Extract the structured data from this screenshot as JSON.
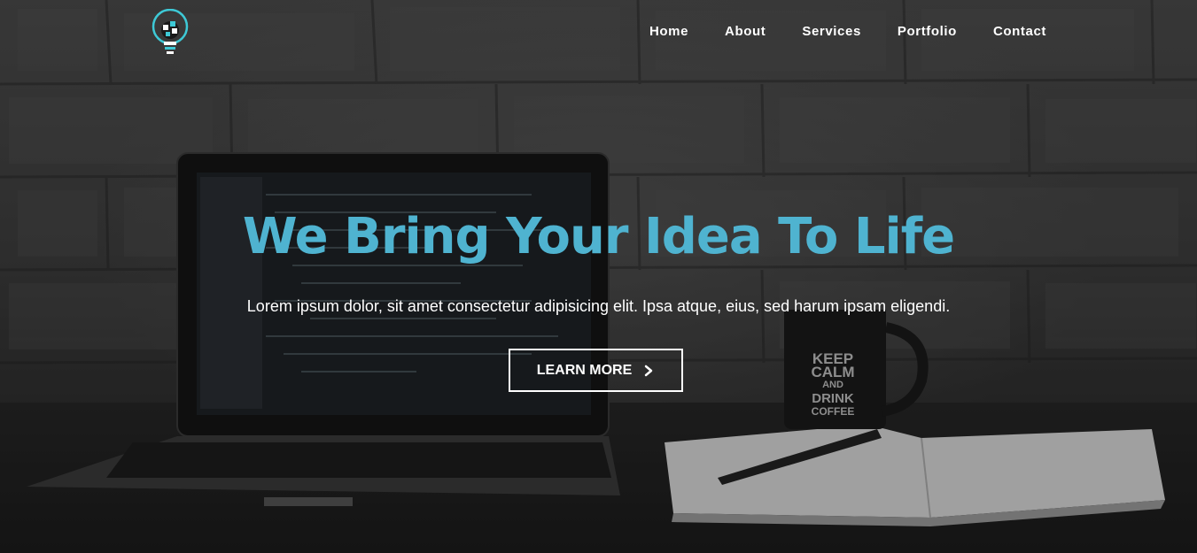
{
  "nav": {
    "logo_icon": "lightbulb-logo-icon",
    "items": [
      {
        "label": "Home"
      },
      {
        "label": "About"
      },
      {
        "label": "Services"
      },
      {
        "label": "Portfolio"
      },
      {
        "label": "Contact"
      }
    ]
  },
  "hero": {
    "headline": "We Bring Your Idea To Life",
    "subtitle": "Lorem ipsum dolor, sit amet consectetur adipisicing elit. Ipsa atque, eius, sed harum ipsam eligendi.",
    "cta_label": "LEARN MORE",
    "cta_icon": "chevron-right-icon",
    "mug_text": [
      "KEEP",
      "CALM",
      "AND",
      "DRINK",
      "COFFEE"
    ]
  },
  "colors": {
    "accent": "#4fb3d0",
    "text": "#ffffff",
    "logo_ring": "#3ec9d6"
  }
}
